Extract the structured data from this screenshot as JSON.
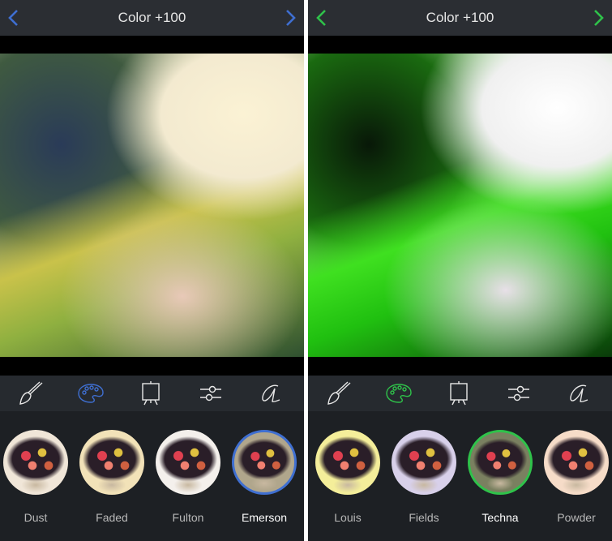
{
  "left": {
    "title": "Color +100",
    "accent": "#3f6fd1",
    "tools": [
      "brush-icon",
      "palette-icon",
      "easel-icon",
      "sliders-icon",
      "font-icon"
    ],
    "active_tool": 1,
    "filters": [
      {
        "label": "Dust",
        "selected": false,
        "tint": "#f0e6d8"
      },
      {
        "label": "Faded",
        "selected": false,
        "tint": "#f2e2b8"
      },
      {
        "label": "Fulton",
        "selected": false,
        "tint": "#f4f0ec"
      },
      {
        "label": "Emerson",
        "selected": true,
        "tint": "#b0a68c"
      }
    ]
  },
  "right": {
    "title": "Color +100",
    "accent": "#2fc24a",
    "tools": [
      "brush-icon",
      "palette-icon",
      "easel-icon",
      "sliders-icon",
      "font-icon"
    ],
    "active_tool": 1,
    "filters": [
      {
        "label": "Louis",
        "selected": false,
        "tint": "#f4ee9a"
      },
      {
        "label": "Fields",
        "selected": false,
        "tint": "#d8d0ea"
      },
      {
        "label": "Techna",
        "selected": true,
        "tint": "#7a8060"
      },
      {
        "label": "Powder",
        "selected": false,
        "tint": "#f6dcc8"
      }
    ]
  }
}
